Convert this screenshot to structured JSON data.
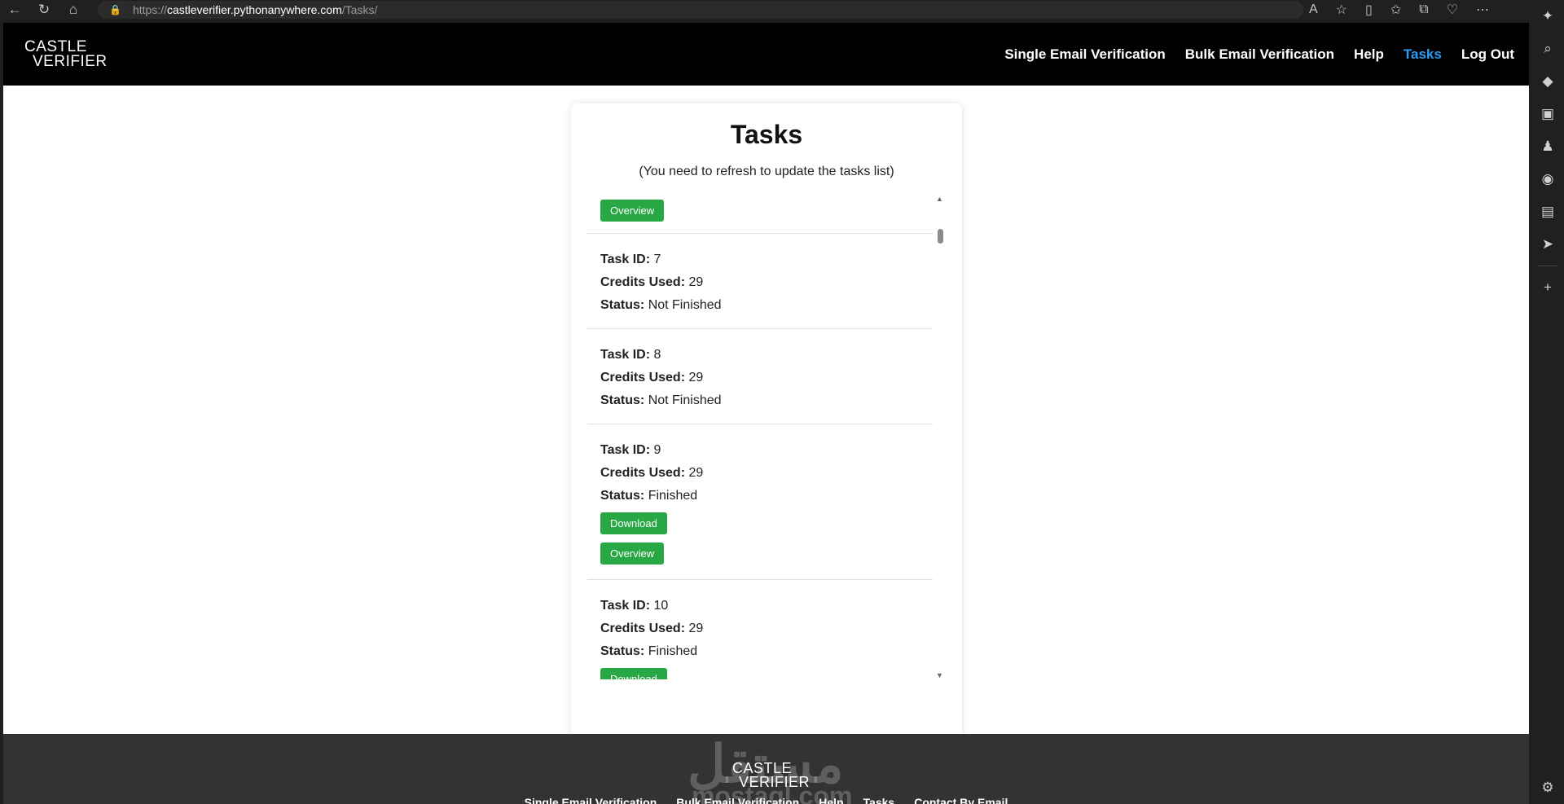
{
  "browser": {
    "url_scheme": "https://",
    "url_host": "castleverifier.pythonanywhere.com",
    "url_path": "/Tasks/"
  },
  "header": {
    "logo_line1": "CASTLE",
    "logo_line2": "VERIFIER",
    "nav": [
      {
        "label": "Single Email Verification"
      },
      {
        "label": "Bulk Email Verification"
      },
      {
        "label": "Help"
      },
      {
        "label": "Tasks",
        "active": true
      },
      {
        "label": "Log Out"
      }
    ]
  },
  "main": {
    "title": "Tasks",
    "note": "(You need to refresh to update the tasks list)",
    "labels": {
      "task_id": "Task ID:",
      "credits_used": "Credits Used:",
      "status": "Status:",
      "overview": "Overview",
      "download": "Download"
    },
    "tasks": [
      {
        "task_id": "7",
        "credits_used": "29",
        "status": "Not Finished"
      },
      {
        "task_id": "8",
        "credits_used": "29",
        "status": "Not Finished"
      },
      {
        "task_id": "9",
        "credits_used": "29",
        "status": "Finished"
      },
      {
        "task_id": "10",
        "credits_used": "29",
        "status": "Finished"
      }
    ]
  },
  "footer": {
    "logo_line1": "CASTLE",
    "logo_line2": "VERIFIER",
    "links": [
      {
        "label": "Single Email Verification"
      },
      {
        "label": "Bulk Email Verification"
      },
      {
        "label": "Help"
      },
      {
        "label": "Tasks"
      },
      {
        "label": "Contact By Email"
      }
    ],
    "watermark_ar": "مستقل",
    "watermark_en": "mostaql.com"
  },
  "colors": {
    "accent": "#2a9df4",
    "button": "#28a745",
    "header_bg": "#000000",
    "footer_bg": "#333333"
  }
}
